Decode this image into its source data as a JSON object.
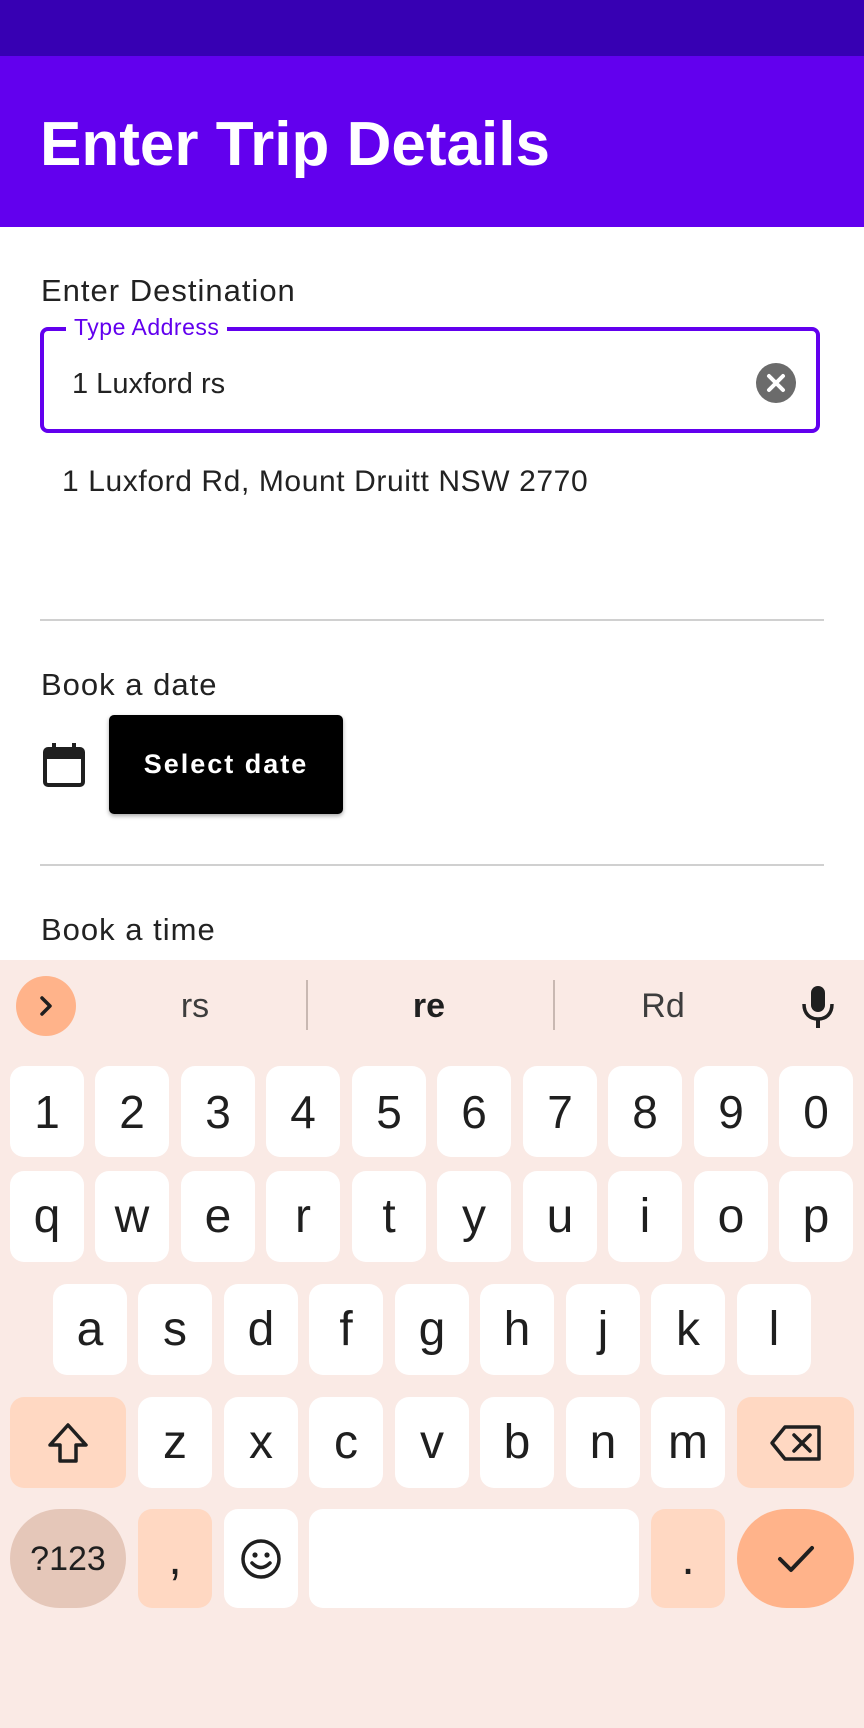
{
  "app_bar": {
    "title": "Enter Trip Details"
  },
  "destination": {
    "section_label": "Enter Destination",
    "field_label": "Type Address",
    "value": "1 Luxford rs",
    "suggestion": "1 Luxford Rd, Mount Druitt NSW 2770"
  },
  "date": {
    "section_label": "Book a date",
    "button_label": "Select date"
  },
  "time": {
    "section_label": "Book a time"
  },
  "keyboard": {
    "suggestions": [
      "rs",
      "re",
      "Rd"
    ],
    "number_row": [
      "1",
      "2",
      "3",
      "4",
      "5",
      "6",
      "7",
      "8",
      "9",
      "0"
    ],
    "row1": [
      "q",
      "w",
      "e",
      "r",
      "t",
      "y",
      "u",
      "i",
      "o",
      "p"
    ],
    "row2": [
      "a",
      "s",
      "d",
      "f",
      "g",
      "h",
      "j",
      "k",
      "l"
    ],
    "row3": [
      "z",
      "x",
      "c",
      "v",
      "b",
      "n",
      "m"
    ],
    "symbols_label": "?123",
    "comma": ",",
    "period": "."
  },
  "colors": {
    "status_bar": "#3700b3",
    "app_bar": "#6200ee",
    "accent": "#6200ee",
    "keyboard_bg": "#faeae5",
    "key_accent": "#ffd8c2",
    "enter_key": "#ffb38a"
  },
  "icons": {
    "clear": "close-circle-icon",
    "calendar": "calendar-icon",
    "suggestion_toggle": "chevron-right-icon",
    "voice": "microphone-icon",
    "shift": "shift-icon",
    "backspace": "backspace-icon",
    "emoji": "emoji-icon",
    "enter": "checkmark-icon"
  }
}
